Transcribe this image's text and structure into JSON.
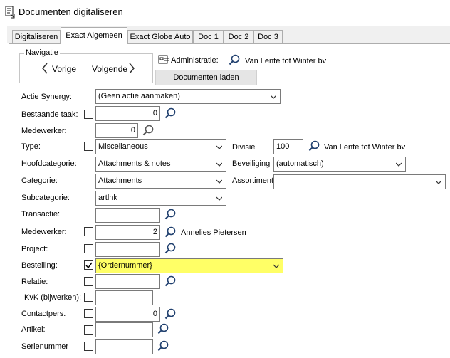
{
  "window": {
    "title": "Documenten digitaliseren"
  },
  "tabs": [
    {
      "label": "Digitaliseren",
      "active": false
    },
    {
      "label": "Exact Algemeen",
      "active": true
    },
    {
      "label": "Exact Globe Auto",
      "active": false
    },
    {
      "label": "Doc 1",
      "active": false
    },
    {
      "label": "Doc 2",
      "active": false
    },
    {
      "label": "Doc 3",
      "active": false
    }
  ],
  "navigatie": {
    "label": "Navigatie",
    "prev": "Vorige",
    "next": "Volgende"
  },
  "administratie": {
    "label": "Administratie:",
    "value": "Van Lente tot Winter bv"
  },
  "load_button": "Documenten laden",
  "form": {
    "actie_synergy": {
      "label": "Actie Synergy:",
      "value": "(Geen actie aanmaken)"
    },
    "bestaande_taak": {
      "label": "Bestaande taak:",
      "value": "0",
      "checked": false
    },
    "medewerker1": {
      "label": "Medewerker:",
      "value": "0"
    },
    "type": {
      "label": "Type:",
      "value": "Miscellaneous",
      "checked": false
    },
    "divisie": {
      "label": "Divisie",
      "value": "100",
      "name": "Van Lente tot Winter bv"
    },
    "hoofdcategorie": {
      "label": "Hoofdcategorie:",
      "value": "Attachments & notes"
    },
    "beveiliging": {
      "label": "Beveiliging",
      "value": "(automatisch)"
    },
    "categorie": {
      "label": "Categorie:",
      "value": "Attachments"
    },
    "assortiment": {
      "label": "Assortiment",
      "value": ""
    },
    "subcategorie": {
      "label": "Subcategorie:",
      "value": "artlnk"
    },
    "transactie": {
      "label": "Transactie:",
      "value": ""
    },
    "medewerker2": {
      "label": "Medewerker:",
      "value": "2",
      "name": "Annelies Pietersen",
      "checked": false
    },
    "project": {
      "label": "Project:",
      "value": "",
      "checked": false
    },
    "bestelling": {
      "label": "Bestelling:",
      "value": "{Ordernummer}",
      "checked": true
    },
    "relatie": {
      "label": "Relatie:",
      "value": "",
      "checked": false
    },
    "kvk": {
      "label": "KvK (bijwerken):",
      "value": "",
      "checked": false
    },
    "contactpers": {
      "label": "Contactpers.",
      "value": "0",
      "checked": false
    },
    "artikel": {
      "label": "Artikel:",
      "value": "",
      "checked": false
    },
    "serienummer": {
      "label": "Serienummer",
      "value": "",
      "checked": false
    }
  },
  "colors": {
    "highlight": "#ffff66",
    "border": "#7a7a7a",
    "tab_bg": "#f0f0f0",
    "icon_blue": "#1f3f6e"
  }
}
